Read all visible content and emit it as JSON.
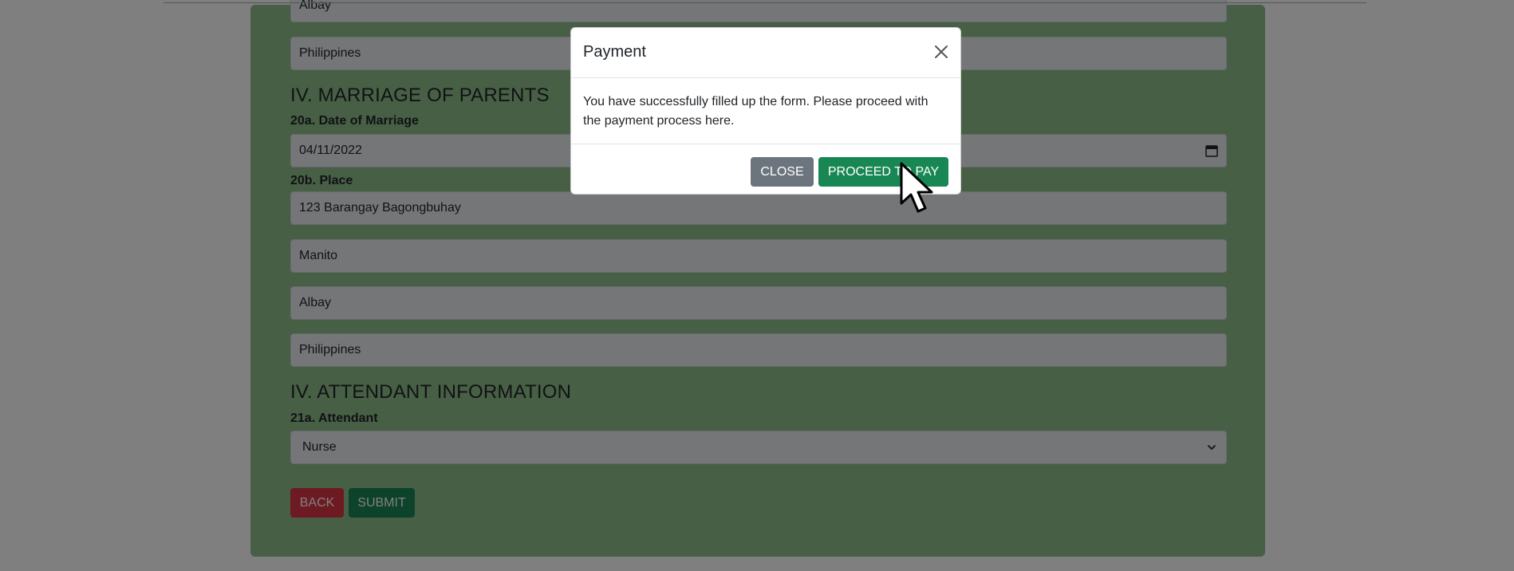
{
  "form": {
    "top_partial_value": "Albay",
    "country_value_top": "Philippines",
    "section_marriage": "IV. MARRIAGE OF PARENTS",
    "date_label": "20a. Date of Marriage",
    "date_value": "04/11/2022",
    "place_label": "20b. Place",
    "place_street": "123 Barangay Bagongbuhay",
    "place_city": "Manito",
    "place_province": "Albay",
    "place_country": "Philippines",
    "section_attendant": "IV. ATTENDANT INFORMATION",
    "attendant_label": "21a. Attendant",
    "attendant_value": "Nurse",
    "back_label": "BACK",
    "submit_label": "SUBMIT"
  },
  "modal": {
    "title": "Payment",
    "message": "You have successfully filled up the form. Please proceed with the payment process here.",
    "close_label": "CLOSE",
    "proceed_label": "PROCEED TO PAY"
  },
  "icons": {
    "modal_close": "close-icon",
    "date": "calendar-icon",
    "select": "chevron-down-icon",
    "pointer": "cursor-pointer-icon"
  },
  "colors": {
    "form_bg": "#8fbf8a",
    "success": "#198754",
    "danger": "#dc3545",
    "secondary": "#6c757d"
  }
}
